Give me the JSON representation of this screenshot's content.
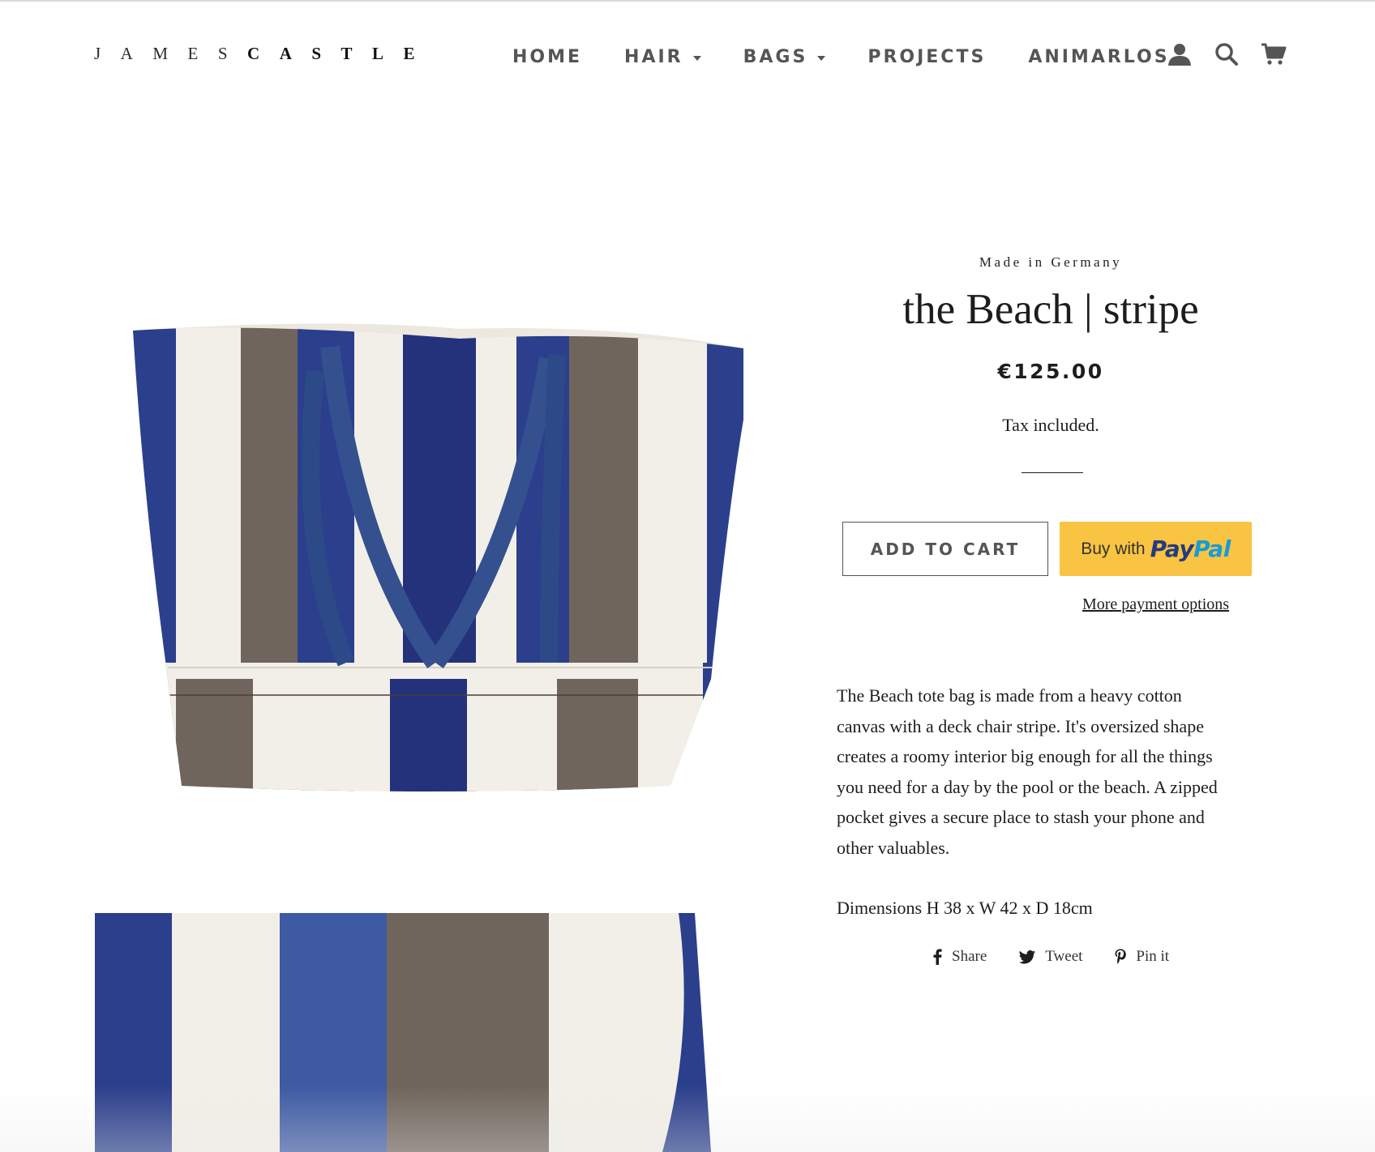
{
  "header": {
    "logo_light": "JAMES",
    "logo_bold": "CASTLE",
    "nav": {
      "home": "HOME",
      "hair": "HAIR",
      "bags": "BAGS",
      "projects": "PROJECTS",
      "animarlos": "ANIMARLOS"
    },
    "icons": [
      "account-icon",
      "search-icon",
      "cart-icon"
    ]
  },
  "product": {
    "vendor": "Made in Germany",
    "title": "the Beach | stripe",
    "price": "€125.00",
    "tax_note": "Tax included.",
    "add_to_cart": "ADD TO CART",
    "paypal_prefix": "Buy with",
    "paypal_pay": "Pay",
    "paypal_pal": "Pal",
    "more_payment": "More payment options",
    "description_lines": [
      "The Beach tote bag is made from a heavy cotton",
      "canvas with a deck chair stripe. It's  oversized shape",
      "creates a roomy interior big enough for all the things",
      "you need for a day by the pool or the beach. A zipped",
      "pocket gives a secure place to stash your phone and",
      "other valuables."
    ],
    "dimensions": "Dimensions H 38 x W 42 x D 18cm"
  },
  "share": {
    "facebook": "Share",
    "twitter": "Tweet",
    "pinterest": "Pin it"
  },
  "colors": {
    "text": "#1c1d1d",
    "nav": "#555555",
    "paypal_bg": "#f8c441",
    "paypal_pay": "#253b80",
    "paypal_pal": "#179bd7",
    "stripe_blue": "#2b3f8c",
    "stripe_brown": "#6f655c",
    "stripe_cream": "#f2efe8"
  }
}
